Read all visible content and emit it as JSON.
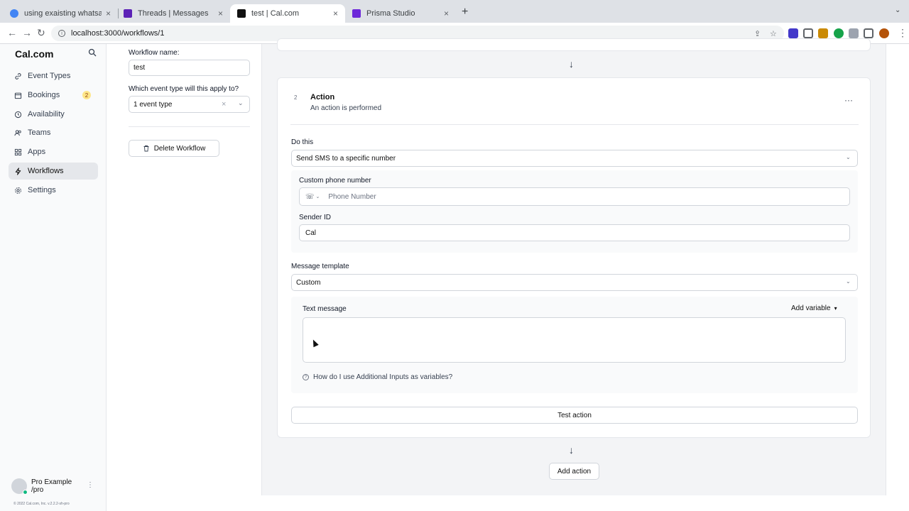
{
  "browser": {
    "tabs": [
      {
        "title": "using exaisting whatsapp numb",
        "favicon_color": "#4285f4",
        "active": false
      },
      {
        "title": "Threads | Messages",
        "favicon_color": "#5b21b6",
        "active": false
      },
      {
        "title": "test | Cal.com",
        "favicon_color": "#111111",
        "active": true
      },
      {
        "title": "Prisma Studio",
        "favicon_color": "#6d28d9",
        "active": false
      }
    ],
    "close_glyph": "×",
    "new_tab_glyph": "+",
    "url": "localhost:3000/workflows/1"
  },
  "sidebar": {
    "logo": "Cal.com",
    "items": [
      {
        "label": "Event Types",
        "icon": "link-icon",
        "active": false
      },
      {
        "label": "Bookings",
        "icon": "calendar-icon",
        "active": false,
        "badge": "2"
      },
      {
        "label": "Availability",
        "icon": "clock-icon",
        "active": false
      },
      {
        "label": "Teams",
        "icon": "users-icon",
        "active": false
      },
      {
        "label": "Apps",
        "icon": "grid-icon",
        "active": false
      },
      {
        "label": "Workflows",
        "icon": "zap-icon",
        "active": true
      },
      {
        "label": "Settings",
        "icon": "gear-icon",
        "active": false
      }
    ],
    "user": {
      "name": "Pro Example",
      "handle": "/pro"
    },
    "copyright": "© 2022 Cal.com, Inc. v.2.2.2-sh-pro"
  },
  "workflow_panel": {
    "name_label": "Workflow name:",
    "name_value": "test",
    "event_type_label": "Which event type will this apply to?",
    "event_type_value": "1 event type",
    "delete_label": "Delete Workflow"
  },
  "action": {
    "step_number": "2",
    "title": "Action",
    "subtitle": "An action is performed",
    "do_this_label": "Do this",
    "do_this_value": "Send SMS to a specific number",
    "phone_label": "Custom phone number",
    "phone_placeholder": "Phone Number",
    "sender_label": "Sender ID",
    "sender_value": "Cal",
    "template_label": "Message template",
    "template_value": "Custom",
    "text_message_label": "Text message",
    "add_variable_label": "Add variable",
    "help_text": "How do I use Additional Inputs as variables?",
    "test_action_label": "Test action"
  },
  "add_action_label": "Add action",
  "colors": {
    "accent": "#111827",
    "active_nav_bg": "#e5e7eb",
    "badge_bg": "#fde68a",
    "online": "#10b981"
  }
}
